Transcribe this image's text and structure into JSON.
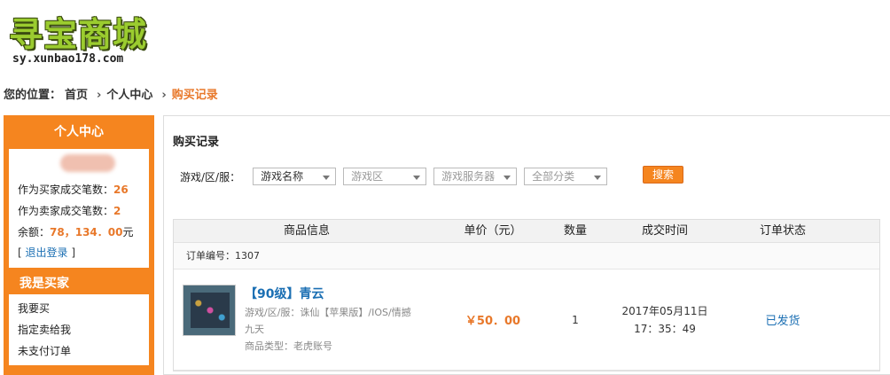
{
  "logo": {
    "text": "寻宝商城",
    "url": "sy.xunbao178.com"
  },
  "breadcrumb": {
    "prefix": "您的位置：",
    "home": "首页",
    "center": "个人中心",
    "current": "购买记录"
  },
  "sidebar": {
    "title": "个人中心",
    "buyer_deals_label": "作为买家成交笔数：",
    "buyer_deals_value": "26",
    "seller_deals_label": "作为卖家成交笔数：",
    "seller_deals_value": "2",
    "balance_label": "余额：",
    "balance_value": "78，134．00",
    "balance_unit": "元",
    "logout_open": "[",
    "logout_label": "退出登录",
    "logout_close": "]",
    "buyer_section": "我是买家",
    "buyer_items": [
      "我要买",
      "指定卖给我",
      "未支付订单"
    ]
  },
  "main": {
    "title": "购买记录",
    "filter_label": "游戏/区/服：",
    "filters": [
      {
        "label": "游戏名称"
      },
      {
        "label": "游戏区"
      },
      {
        "label": "游戏服务器"
      },
      {
        "label": "全部分类"
      }
    ],
    "search_label": "搜索"
  },
  "table": {
    "headers": {
      "info": "商品信息",
      "price": "单价（元）",
      "qty": "数量",
      "time": "成交时间",
      "status": "订单状态"
    },
    "order_no": "订单编号：1307",
    "row": {
      "name": "【90级】青云",
      "detail1": "游戏/区/服：诛仙【苹果版】/IOS/情撼",
      "detail2": "九天",
      "type": "商品类型：老虎账号",
      "price": "￥50．00",
      "qty": "1",
      "date": "2017年05月11日",
      "clock": "17：35：49",
      "status": "已发货"
    }
  },
  "colors": {
    "accent": "#f5851f",
    "link": "#1b6fb3",
    "price": "#e8782a"
  }
}
